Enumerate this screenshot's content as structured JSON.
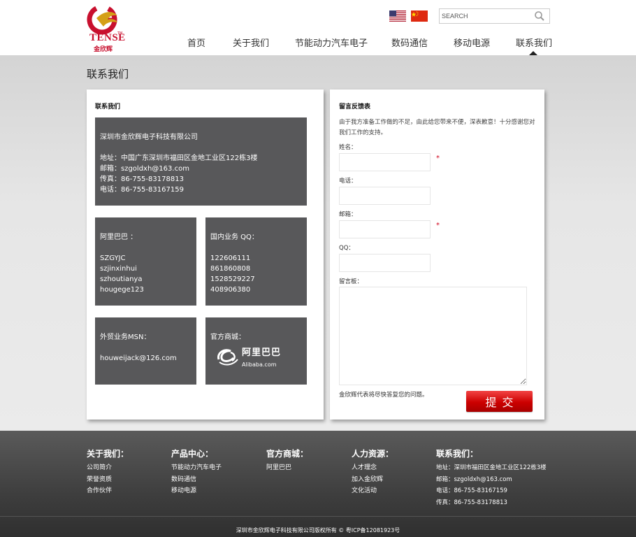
{
  "brand": {
    "logo_text": "TENSE",
    "logo_tm": "TM",
    "logo_cn": "金欣辉"
  },
  "search": {
    "placeholder": "SEARCH"
  },
  "nav": {
    "items": [
      "首页",
      "关于我们",
      "节能动力汽车电子",
      "数码通信",
      "移动电源",
      "联系我们"
    ],
    "active_index": 5
  },
  "page_title": "联系我们",
  "contact_panel": {
    "heading": "联系我们",
    "company": {
      "name": "深圳市金欣辉电子科技有限公司",
      "address": "地址：中国广东深圳市福田区金地工业区122栋3楼",
      "email": "邮箱：szgoldxh@163.com",
      "fax": "传真：86-755-83178813",
      "phone": "电话：86-755-83167159"
    },
    "alibaba": {
      "title": "阿里巴巴 ：",
      "ids": [
        "SZGYJC",
        "szjinxinhui",
        "szhoutianya",
        "hougege123"
      ]
    },
    "qq": {
      "title": "国内业务 QQ：",
      "numbers": [
        "122606111",
        "861860808",
        "1528529227",
        "408906380"
      ]
    },
    "msn": {
      "title": "外贸业务MSN：",
      "account": "houweijack@126.com"
    },
    "store": {
      "title": "官方商城：",
      "logo_cn": "阿里巴巴",
      "logo_en": "Alibaba.com"
    }
  },
  "form_panel": {
    "heading": "留言反馈表",
    "intro": "由于我方准备工作做的不足，由此给您带来不便，深表歉意！十分感谢您对我们工作的支持。",
    "fields": {
      "name_label": "姓名：",
      "phone_label": "电话：",
      "email_label": "邮箱：",
      "qq_label": "QQ：",
      "message_label": "留言板："
    },
    "required_mark": "*",
    "note": "金欣辉代表将尽快答复您的问题。",
    "submit_label": "提交"
  },
  "footer": {
    "about": {
      "title": "关于我们：",
      "links": [
        "公司简介",
        "荣誉资质",
        "合作伙伴"
      ]
    },
    "products": {
      "title": "产品中心：",
      "links": [
        "节能动力汽车电子",
        "数码通信",
        "移动电源"
      ]
    },
    "store": {
      "title": "官方商城：",
      "links": [
        "阿里巴巴"
      ]
    },
    "hr": {
      "title": "人力资源：",
      "links": [
        "人才理念",
        "加入金欣辉",
        "文化活动"
      ]
    },
    "contact": {
      "title": "联系我们：",
      "lines": [
        "地址：深圳市福田区金地工业区122栋3楼",
        "邮箱：szgoldxh@163.com",
        "电话：86-755-83167159",
        "传真：86-755-83178813"
      ]
    },
    "copyright": "深圳市金欣辉电子科技有限公司版权所有 © 粤ICP备12081923号"
  },
  "colors": {
    "brand_red": "#c8102e",
    "box_gray": "#58585a",
    "footer_dark": "#3e3e3e",
    "submit_red": "#cc0000"
  }
}
